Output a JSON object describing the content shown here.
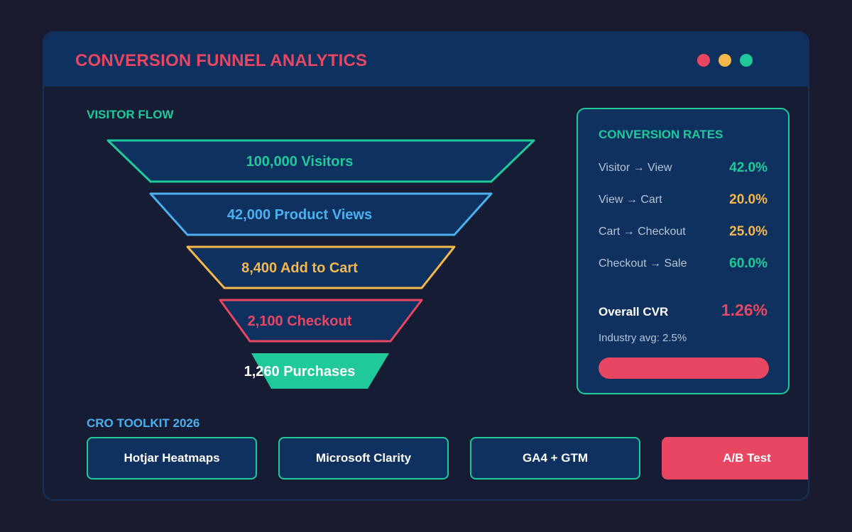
{
  "header": {
    "title": "CONVERSION FUNNEL ANALYTICS",
    "window_controls": [
      "close",
      "minimize",
      "maximize"
    ]
  },
  "funnel": {
    "label": "VISITOR FLOW",
    "stages": [
      {
        "label": "100,000 Visitors",
        "value": 100000,
        "color": "#1fc99a"
      },
      {
        "label": "42,000 Product Views",
        "value": 42000,
        "color": "#4bb0ef"
      },
      {
        "label": "8,400 Add to Cart",
        "value": 8400,
        "color": "#f6b84b"
      },
      {
        "label": "2,100 Checkout",
        "value": 2100,
        "color": "#e94662"
      },
      {
        "label": "1,260 Purchases",
        "value": 1260,
        "color": "#1fc99a"
      }
    ]
  },
  "rates": {
    "title": "CONVERSION RATES",
    "items": [
      {
        "label": "Visitor → View",
        "value": "42.0%",
        "color": "#1fc99a"
      },
      {
        "label": "View → Cart",
        "value": "20.0%",
        "color": "#f6b84b"
      },
      {
        "label": "Cart → Checkout",
        "value": "25.0%",
        "color": "#f6b84b"
      },
      {
        "label": "Checkout → Sale",
        "value": "60.0%",
        "color": "#1fc99a"
      }
    ],
    "overall_label": "Overall CVR",
    "overall_value": "1.26%",
    "industry": "Industry avg: 2.5%",
    "progress_fraction": 1.0
  },
  "toolkit": {
    "label": "CRO TOOLKIT 2026",
    "items": [
      "Hotjar Heatmaps",
      "Microsoft Clarity",
      "GA4 + GTM",
      "A/B Test"
    ]
  },
  "colors": {
    "accent_red": "#e94662",
    "accent_green": "#1fc99a",
    "accent_blue": "#4bb0ef",
    "accent_yellow": "#f6b84b"
  }
}
